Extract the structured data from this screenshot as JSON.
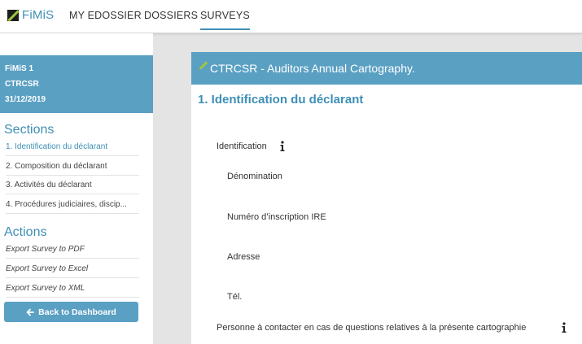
{
  "nav": {
    "brand": "FiMiS",
    "links": [
      "MY EDOSSIER",
      "DOSSIERS",
      "SURVEYS"
    ]
  },
  "sidebar": {
    "info": [
      "FiMiS 1",
      "CTRCSR",
      "31/12/2019"
    ],
    "sections_heading": "Sections",
    "sections": [
      "1. Identification du déclarant",
      "2. Composition du déclarant",
      "3. Activités du déclarant",
      "4. Procédures judiciaires, discip..."
    ],
    "actions_heading": "Actions",
    "actions": [
      "Export Survey to PDF",
      "Export Survey to Excel",
      "Export Survey to XML"
    ],
    "back_button": "Back to Dashboard"
  },
  "survey": {
    "title": "CTRCSR - Auditors Annual Cartography.",
    "section_title": "1. Identification du déclarant",
    "group_label": "Identification",
    "fields": [
      "Dénomination",
      "Numéro d’inscription IRE",
      "Adresse",
      "Tél."
    ],
    "contact_label": "Personne à contacter en cas de questions relatives à la présente cartographie"
  },
  "colors": {
    "accent": "#5aa0c3",
    "brand_blue": "#3e8fb6",
    "logo_green": "#9ec63b"
  }
}
